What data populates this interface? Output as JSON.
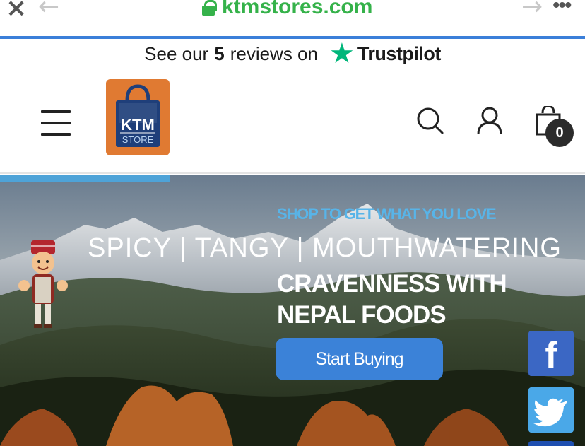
{
  "browser": {
    "url": "ktmstores.com",
    "close_icon": "×",
    "back_icon": "←",
    "forward_icon": "→",
    "more_icon": "•••"
  },
  "trustpilot": {
    "prefix": "See our",
    "count": "5",
    "suffix": "reviews on",
    "brand": "Trustpilot",
    "star_color": "#00b67a"
  },
  "header": {
    "logo_text_top": "KTM",
    "logo_text_bottom": "STORE",
    "cart_count": "0"
  },
  "hero": {
    "tagline": "SHOP TO GET WHAT YOU LOVE",
    "headline": "SPICY | TANGY | MOUTHWATERING",
    "subheadline_line1": "CRAVENNESS WITH",
    "subheadline_line2": "NEPAL FOODS",
    "cta_label": "Start Buying"
  },
  "social": {
    "facebook_glyph": "f"
  },
  "colors": {
    "url_green": "#35b24a",
    "accent_blue": "#3b82d8",
    "tagline_blue": "#58b4e8",
    "logo_orange": "#e07a32",
    "logo_navy": "#1f3f7a",
    "facebook": "#3b67c4",
    "twitter": "#4aa8e8"
  }
}
